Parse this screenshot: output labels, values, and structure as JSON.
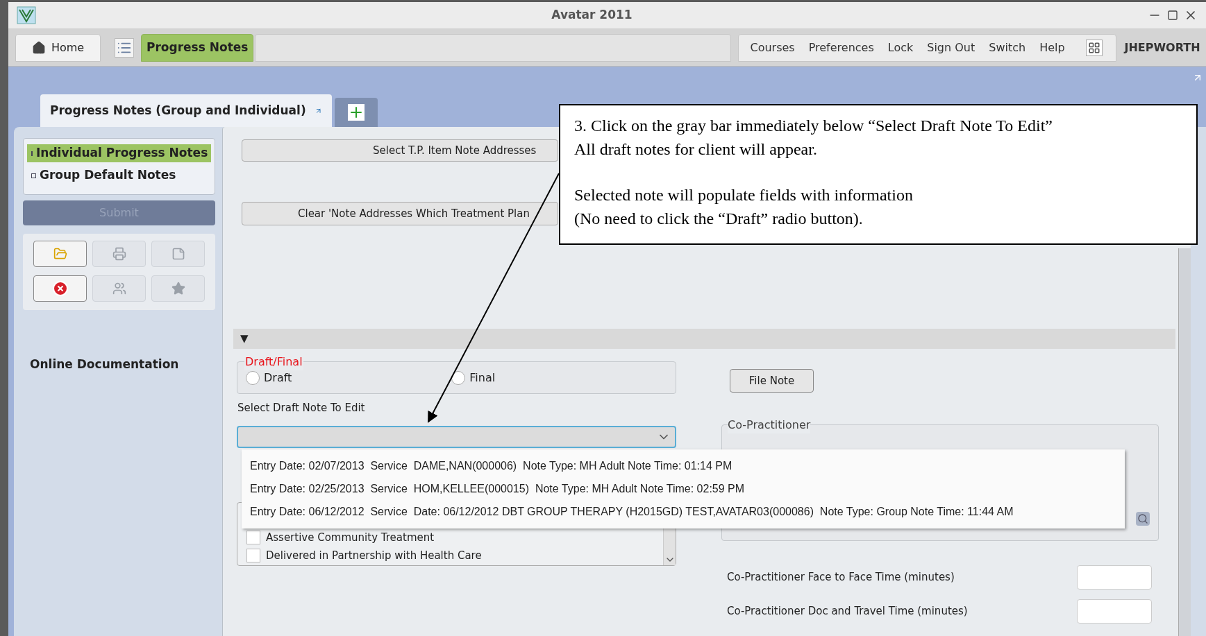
{
  "window": {
    "title": "Avatar 2011"
  },
  "toolbar": {
    "home": "Home",
    "active_form": "Progress Notes",
    "menu": [
      "Courses",
      "Preferences",
      "Lock",
      "Sign Out",
      "Switch",
      "Help"
    ],
    "user": "JHEPWORTH"
  },
  "form_tab": {
    "label": "Progress Notes (Group and Individual)"
  },
  "sidebar": {
    "items": [
      {
        "label": "Individual Progress Notes",
        "selected": true
      },
      {
        "label": "Group Default Notes",
        "selected": false
      }
    ],
    "submit": {
      "label": "Submit",
      "disabled": true
    },
    "tool_buttons": [
      {
        "kind": "folder",
        "disabled": false
      },
      {
        "kind": "print",
        "disabled": true
      },
      {
        "kind": "note",
        "disabled": true
      },
      {
        "kind": "cancel",
        "disabled": false
      },
      {
        "kind": "people",
        "disabled": true
      },
      {
        "kind": "star",
        "disabled": true
      }
    ],
    "link": "Online Documentation"
  },
  "form": {
    "buttons": [
      "Select T.P. Item Note Addresses",
      "Clear 'Note Addresses Which Treatment Plan"
    ],
    "section_toggle": "▼",
    "draft_final": {
      "legend": "Draft/Final",
      "options": [
        {
          "label": "Draft",
          "selected": false
        },
        {
          "label": "Final",
          "selected": false
        }
      ]
    },
    "file_note": "File Note",
    "select_draft": {
      "label": "Select Draft Note To Edit",
      "open": true,
      "options": [
        "Entry Date: 02/07/2013  Service  DAME,NAN(000006)  Note Type: MH Adult Note Time: 01:14 PM",
        "Entry Date: 02/25/2013  Service  HOM,KELLEE(000015)  Note Type: MH Adult Note Time: 02:59 PM",
        "Entry Date: 06/12/2012  Service  Date: 06/12/2012 DBT GROUP THERAPY (H2015GD) TEST,AVATAR03(000086)  Note Type: Group Note Time: 11:44 AM"
      ]
    },
    "programs": [
      {
        "label": "Assertive Community Treatment",
        "checked": false
      },
      {
        "label": "Delivered in Partnership with Health Care",
        "checked": false
      }
    ],
    "co_practitioner": {
      "legend": "Co-Practitioner"
    },
    "time_fields": [
      {
        "label": "Co-Practitioner Face to Face Time (minutes)"
      },
      {
        "label": "Co-Practitioner Doc and Travel Time (minutes)"
      }
    ]
  },
  "callout": {
    "paragraphs": [
      [
        "3. Click on the gray bar immediately below “Select Draft Note To Edit”",
        "All draft notes for client will appear."
      ],
      [
        "Selected note will populate fields with information",
        "(No need to click the “Draft” radio button)."
      ]
    ]
  }
}
